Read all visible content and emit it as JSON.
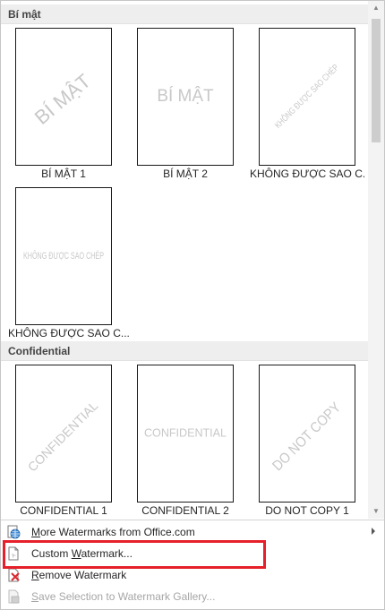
{
  "sections": [
    {
      "title": "Bí mật",
      "items": [
        {
          "label": "BÍ MẬT 1",
          "watermark": "BÍ MẬT"
        },
        {
          "label": "BÍ MẬT 2",
          "watermark": "BÍ MẬT"
        },
        {
          "label": "KHÔNG ĐƯỢC SAO C...",
          "watermark": "KHÔNG ĐƯỢC SAO CHÉP"
        },
        {
          "label": "KHÔNG ĐƯỢC SAO C...",
          "watermark": "KHÔNG ĐƯỢC SAO CHÉP"
        }
      ]
    },
    {
      "title": "Confidential",
      "items": [
        {
          "label": "CONFIDENTIAL 1",
          "watermark": "CONFIDENTIAL"
        },
        {
          "label": "CONFIDENTIAL 2",
          "watermark": "CONFIDENTIAL"
        },
        {
          "label": "DO NOT COPY 1",
          "watermark": "DO NOT COPY"
        }
      ]
    }
  ],
  "menu": [
    {
      "label_pre": "",
      "label_key": "M",
      "label_post": "ore Watermarks from Office.com",
      "icon": "globe-watermark-icon",
      "has_submenu": true,
      "disabled": false
    },
    {
      "label_pre": "Custom ",
      "label_key": "W",
      "label_post": "atermark...",
      "icon": "custom-watermark-icon",
      "has_submenu": false,
      "disabled": false
    },
    {
      "label_pre": "",
      "label_key": "R",
      "label_post": "emove Watermark",
      "icon": "remove-watermark-icon",
      "has_submenu": false,
      "disabled": false
    },
    {
      "label_pre": "",
      "label_key": "S",
      "label_post": "ave Selection to Watermark Gallery...",
      "icon": "save-watermark-icon",
      "has_submenu": false,
      "disabled": true
    }
  ],
  "colors": {
    "highlight": "#e5202a",
    "watermark_text": "#c8c8c8",
    "header_bg": "#eeeeee"
  }
}
